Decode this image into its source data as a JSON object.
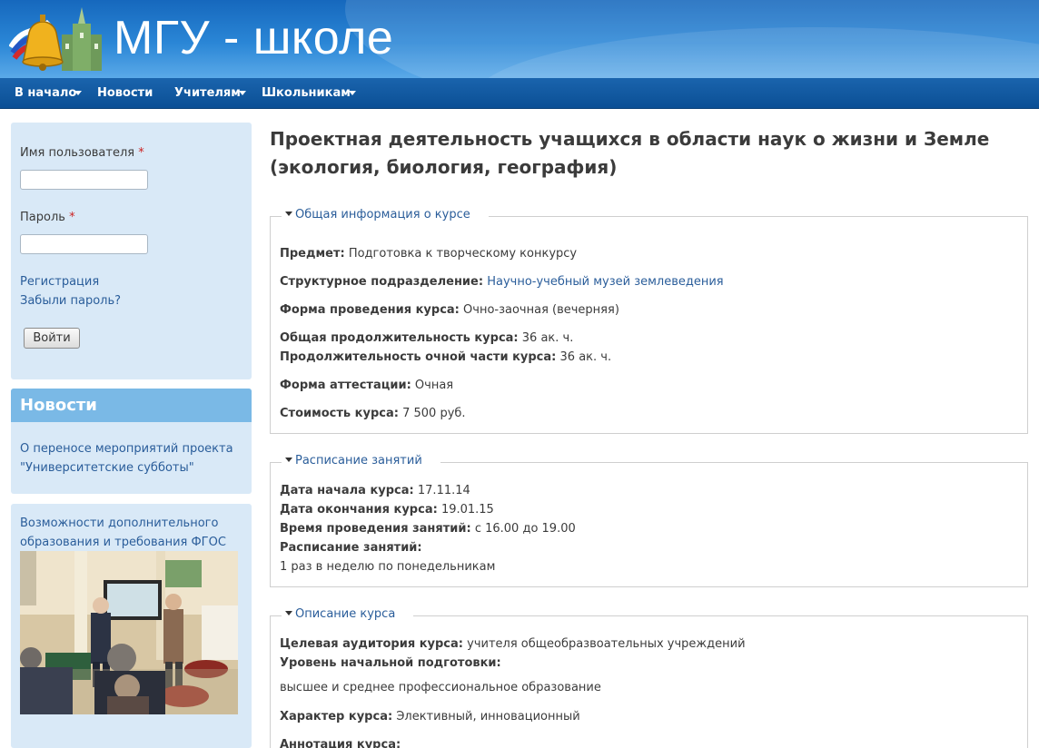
{
  "header": {
    "site_name": "МГУ - школе"
  },
  "nav": {
    "items": [
      {
        "label": "В начало",
        "has_dropdown": true
      },
      {
        "label": "Новости",
        "has_dropdown": false
      },
      {
        "label": "Учителям",
        "has_dropdown": true
      },
      {
        "label": "Школьникам",
        "has_dropdown": true
      }
    ]
  },
  "login": {
    "username_label": "Имя пользователя",
    "password_label": "Пароль",
    "required_mark": "*",
    "register_link": "Регистрация",
    "forgot_link": "Забыли пароль?",
    "submit_label": "Войти"
  },
  "news": {
    "title": "Новости",
    "items": [
      {
        "text": "О переносе мероприятий проекта \"Университетские субботы\""
      }
    ]
  },
  "promo": {
    "link_text": "Возможности дополнительного образования и требования ФГОС"
  },
  "page": {
    "title": "Проектная деятельность учащихся в области наук о жизни и Земле (экология, биология, география)"
  },
  "general": {
    "legend": "Общая информация о курсе",
    "subject_label": "Предмет:",
    "subject_value": "Подготовка к творческому конкурсу",
    "division_label": "Структурное подразделение:",
    "division_value": "Научно-учебный музей землеведения",
    "form_label": "Форма проведения курса:",
    "form_value": "Очно-заочная (вечерняя)",
    "total_duration_label": "Общая продолжительность курса:",
    "total_duration_value": "36 ак. ч.",
    "fulltime_duration_label": "Продолжительность очной части курса:",
    "fulltime_duration_value": "36 ак. ч.",
    "attestation_label": "Форма аттестации:",
    "attestation_value": "Очная",
    "cost_label": "Стоимость курса:",
    "cost_value": "7 500 руб."
  },
  "schedule": {
    "legend": "Расписание занятий",
    "start_label": "Дата начала курса:",
    "start_value": "17.11.14",
    "end_label": "Дата окончания курса:",
    "end_value": "19.01.15",
    "time_label": "Время проведения занятий:",
    "time_value": "с 16.00 до 19.00",
    "schedule_label": "Расписание занятий:",
    "schedule_value": "1 раз в неделю по понедельникам"
  },
  "description": {
    "legend": "Описание курса",
    "audience_label": "Целевая аудитория курса:",
    "audience_value": "учителя общеобразвоательных учреждений",
    "level_label": "Уровень начальной подготовки:",
    "level_value": "высшее и среднее профессиональное образование",
    "character_label": "Характер курса:",
    "character_value": "Элективный, инновационный",
    "annotation_label": "Аннотация курса:"
  }
}
